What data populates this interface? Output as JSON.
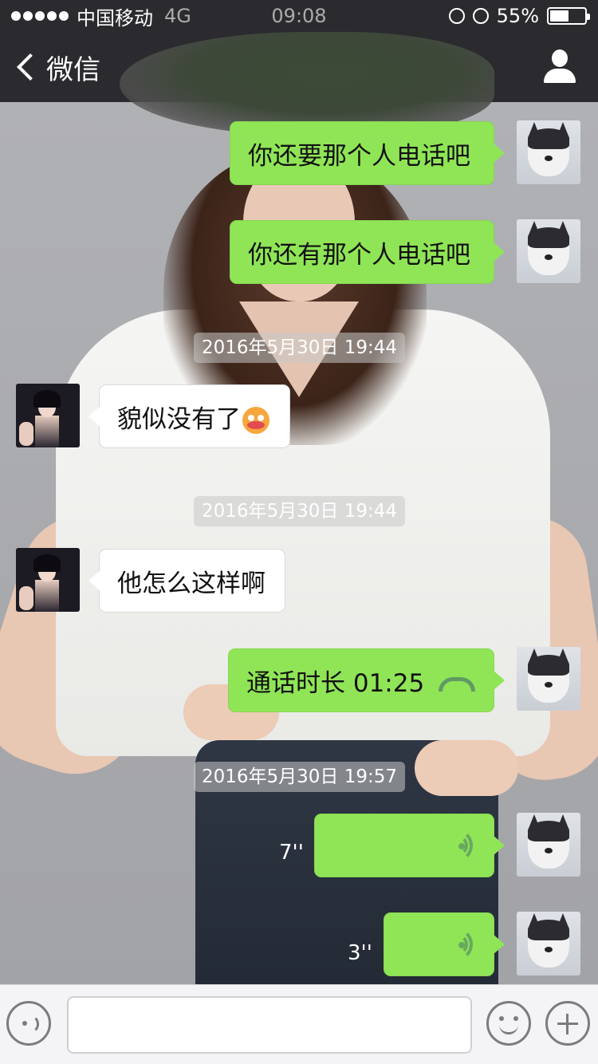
{
  "status_bar": {
    "carrier": "中国移动",
    "network": "4G",
    "time": "09:08",
    "battery_text": "55%",
    "battery_level": 0.55
  },
  "nav": {
    "back_label": "微信",
    "icons": {
      "back": "chevron-left-icon",
      "contact": "person-icon"
    }
  },
  "messages": [
    {
      "from": "me",
      "type": "text",
      "text": "你还要那个人电话吧"
    },
    {
      "from": "me",
      "type": "text",
      "text": "你还有那个人电话吧"
    },
    {
      "type": "timestamp",
      "text": "2016年5月30日 19:44"
    },
    {
      "from": "contact",
      "type": "text",
      "text": "貌似没有了",
      "emoji": "flushed-face-icon"
    },
    {
      "type": "timestamp",
      "text": "2016年5月30日 19:44"
    },
    {
      "from": "contact",
      "type": "text",
      "text": "他怎么这样啊"
    },
    {
      "from": "me",
      "type": "call",
      "text": "通话时长 01:25",
      "icon": "phone-hangup-icon"
    },
    {
      "type": "timestamp",
      "text": "2016年5月30日 19:57"
    },
    {
      "from": "me",
      "type": "voice",
      "duration": "7''",
      "icon": "voice-wave-icon"
    },
    {
      "from": "me",
      "type": "voice",
      "duration": "3''",
      "icon": "voice-wave-icon"
    }
  ],
  "input_bar": {
    "placeholder": "",
    "icons": {
      "voice": "voice-mode-icon",
      "emoji": "emoji-smile-icon",
      "more": "plus-icon"
    }
  },
  "colors": {
    "bubble_me": "#8fe556",
    "bubble_contact": "#ffffff",
    "nav_bg": "#2b2b2f"
  }
}
